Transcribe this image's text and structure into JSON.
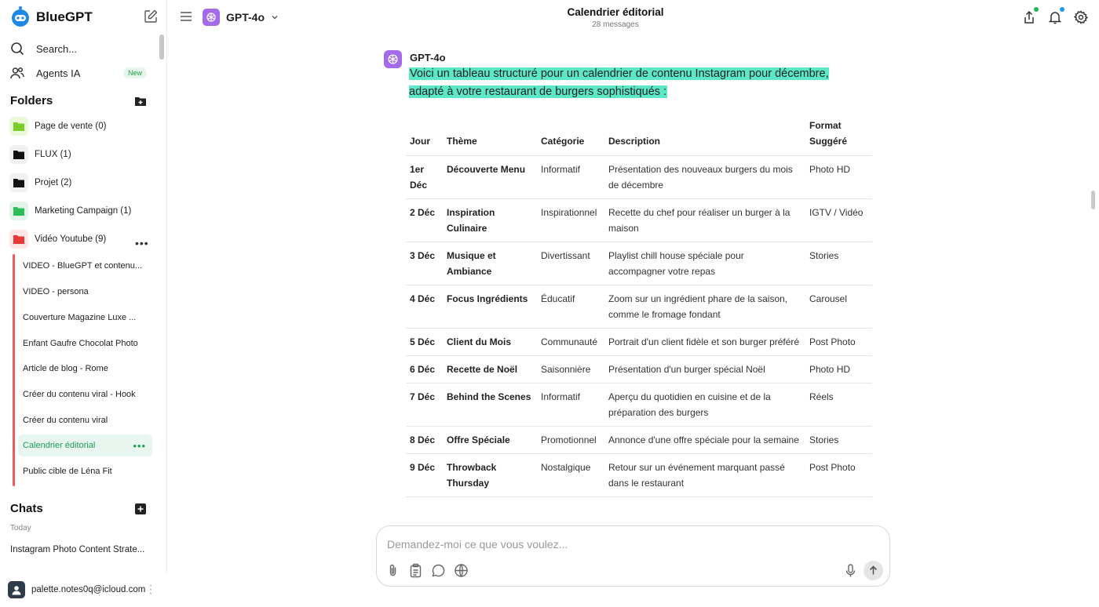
{
  "brand": {
    "name": "BlueGPT"
  },
  "sidebar": {
    "search_label": "Search...",
    "agents_label": "Agents IA",
    "agents_badge": "New",
    "folders_title": "Folders",
    "folders": [
      {
        "label": "Page de vente (0)",
        "color": "#7ccf2b",
        "bg": "#ecf8dc"
      },
      {
        "label": "FLUX (1)",
        "color": "#111111",
        "bg": "#f1f1f1"
      },
      {
        "label": "Projet (2)",
        "color": "#111111",
        "bg": "#f1f1f1"
      },
      {
        "label": "Marketing Campaign (1)",
        "color": "#2fbf5a",
        "bg": "#e4f6e9"
      },
      {
        "label": "Vidéo Youtube (9)",
        "color": "#e53935",
        "bg": "#fde6e6"
      }
    ],
    "subitems": [
      {
        "label": "VIDEO - BlueGPT et contenu..."
      },
      {
        "label": "VIDEO - persona"
      },
      {
        "label": "Couverture Magazine Luxe ..."
      },
      {
        "label": "Enfant Gaufre Chocolat Photo"
      },
      {
        "label": "Article de blog - Rome"
      },
      {
        "label": "Créer du contenu viral - Hook"
      },
      {
        "label": "Créer du contenu viral"
      },
      {
        "label": "Calendrier éditorial"
      },
      {
        "label": "Public cible de Léna Fit"
      }
    ],
    "chats_title": "Chats",
    "today_label": "Today",
    "chat_items": [
      {
        "label": "Instagram Photo Content Strate..."
      }
    ],
    "user_email": "palette.notes0q@icloud.com"
  },
  "topbar": {
    "model_name": "GPT-4o",
    "title": "Calendrier éditorial",
    "subtitle": "28 messages",
    "share_dot_color": "#22b45a",
    "notif_dot_color": "#1e9be8"
  },
  "message": {
    "author": "GPT-4o",
    "intro": "Voici un tableau structuré pour un calendrier de contenu Instagram pour décembre, adapté à votre restaurant de burgers sophistiqués :",
    "highlight_color": "#5ce8c6",
    "table": {
      "headers": [
        "Jour",
        "Thème",
        "Catégorie",
        "Description",
        "Format Suggéré"
      ],
      "rows": [
        [
          "1er Déc",
          "Découverte Menu",
          "Informatif",
          "Présentation des nouveaux burgers du mois de décembre",
          "Photo HD"
        ],
        [
          "2 Déc",
          "Inspiration Culinaire",
          "Inspirationnel",
          "Recette du chef pour réaliser un burger à la maison",
          "IGTV / Vidéo"
        ],
        [
          "3 Déc",
          "Musique et Ambiance",
          "Divertissant",
          "Playlist chill house spéciale pour accompagner votre repas",
          "Stories"
        ],
        [
          "4 Déc",
          "Focus Ingrédients",
          "Éducatif",
          "Zoom sur un ingrédient phare de la saison, comme le fromage fondant",
          "Carousel"
        ],
        [
          "5 Déc",
          "Client du Mois",
          "Communauté",
          "Portrait d'un client fidèle et son burger préféré",
          "Post Photo"
        ],
        [
          "6 Déc",
          "Recette de Noël",
          "Saisonnière",
          "Présentation d'un burger spécial Noël",
          "Photo HD"
        ],
        [
          "7 Déc",
          "Behind the Scenes",
          "Informatif",
          "Aperçu du quotidien en cuisine et de la préparation des burgers",
          "Réels"
        ],
        [
          "8 Déc",
          "Offre Spéciale",
          "Promotionnel",
          "Annonce d'une offre spéciale pour la semaine",
          "Stories"
        ],
        [
          "9 Déc",
          "Throwback Thursday",
          "Nostalgique",
          "Retour sur un événement marquant passé dans le restaurant",
          "Post Photo"
        ]
      ]
    }
  },
  "composer": {
    "placeholder": "Demandez-moi ce que vous voulez..."
  }
}
